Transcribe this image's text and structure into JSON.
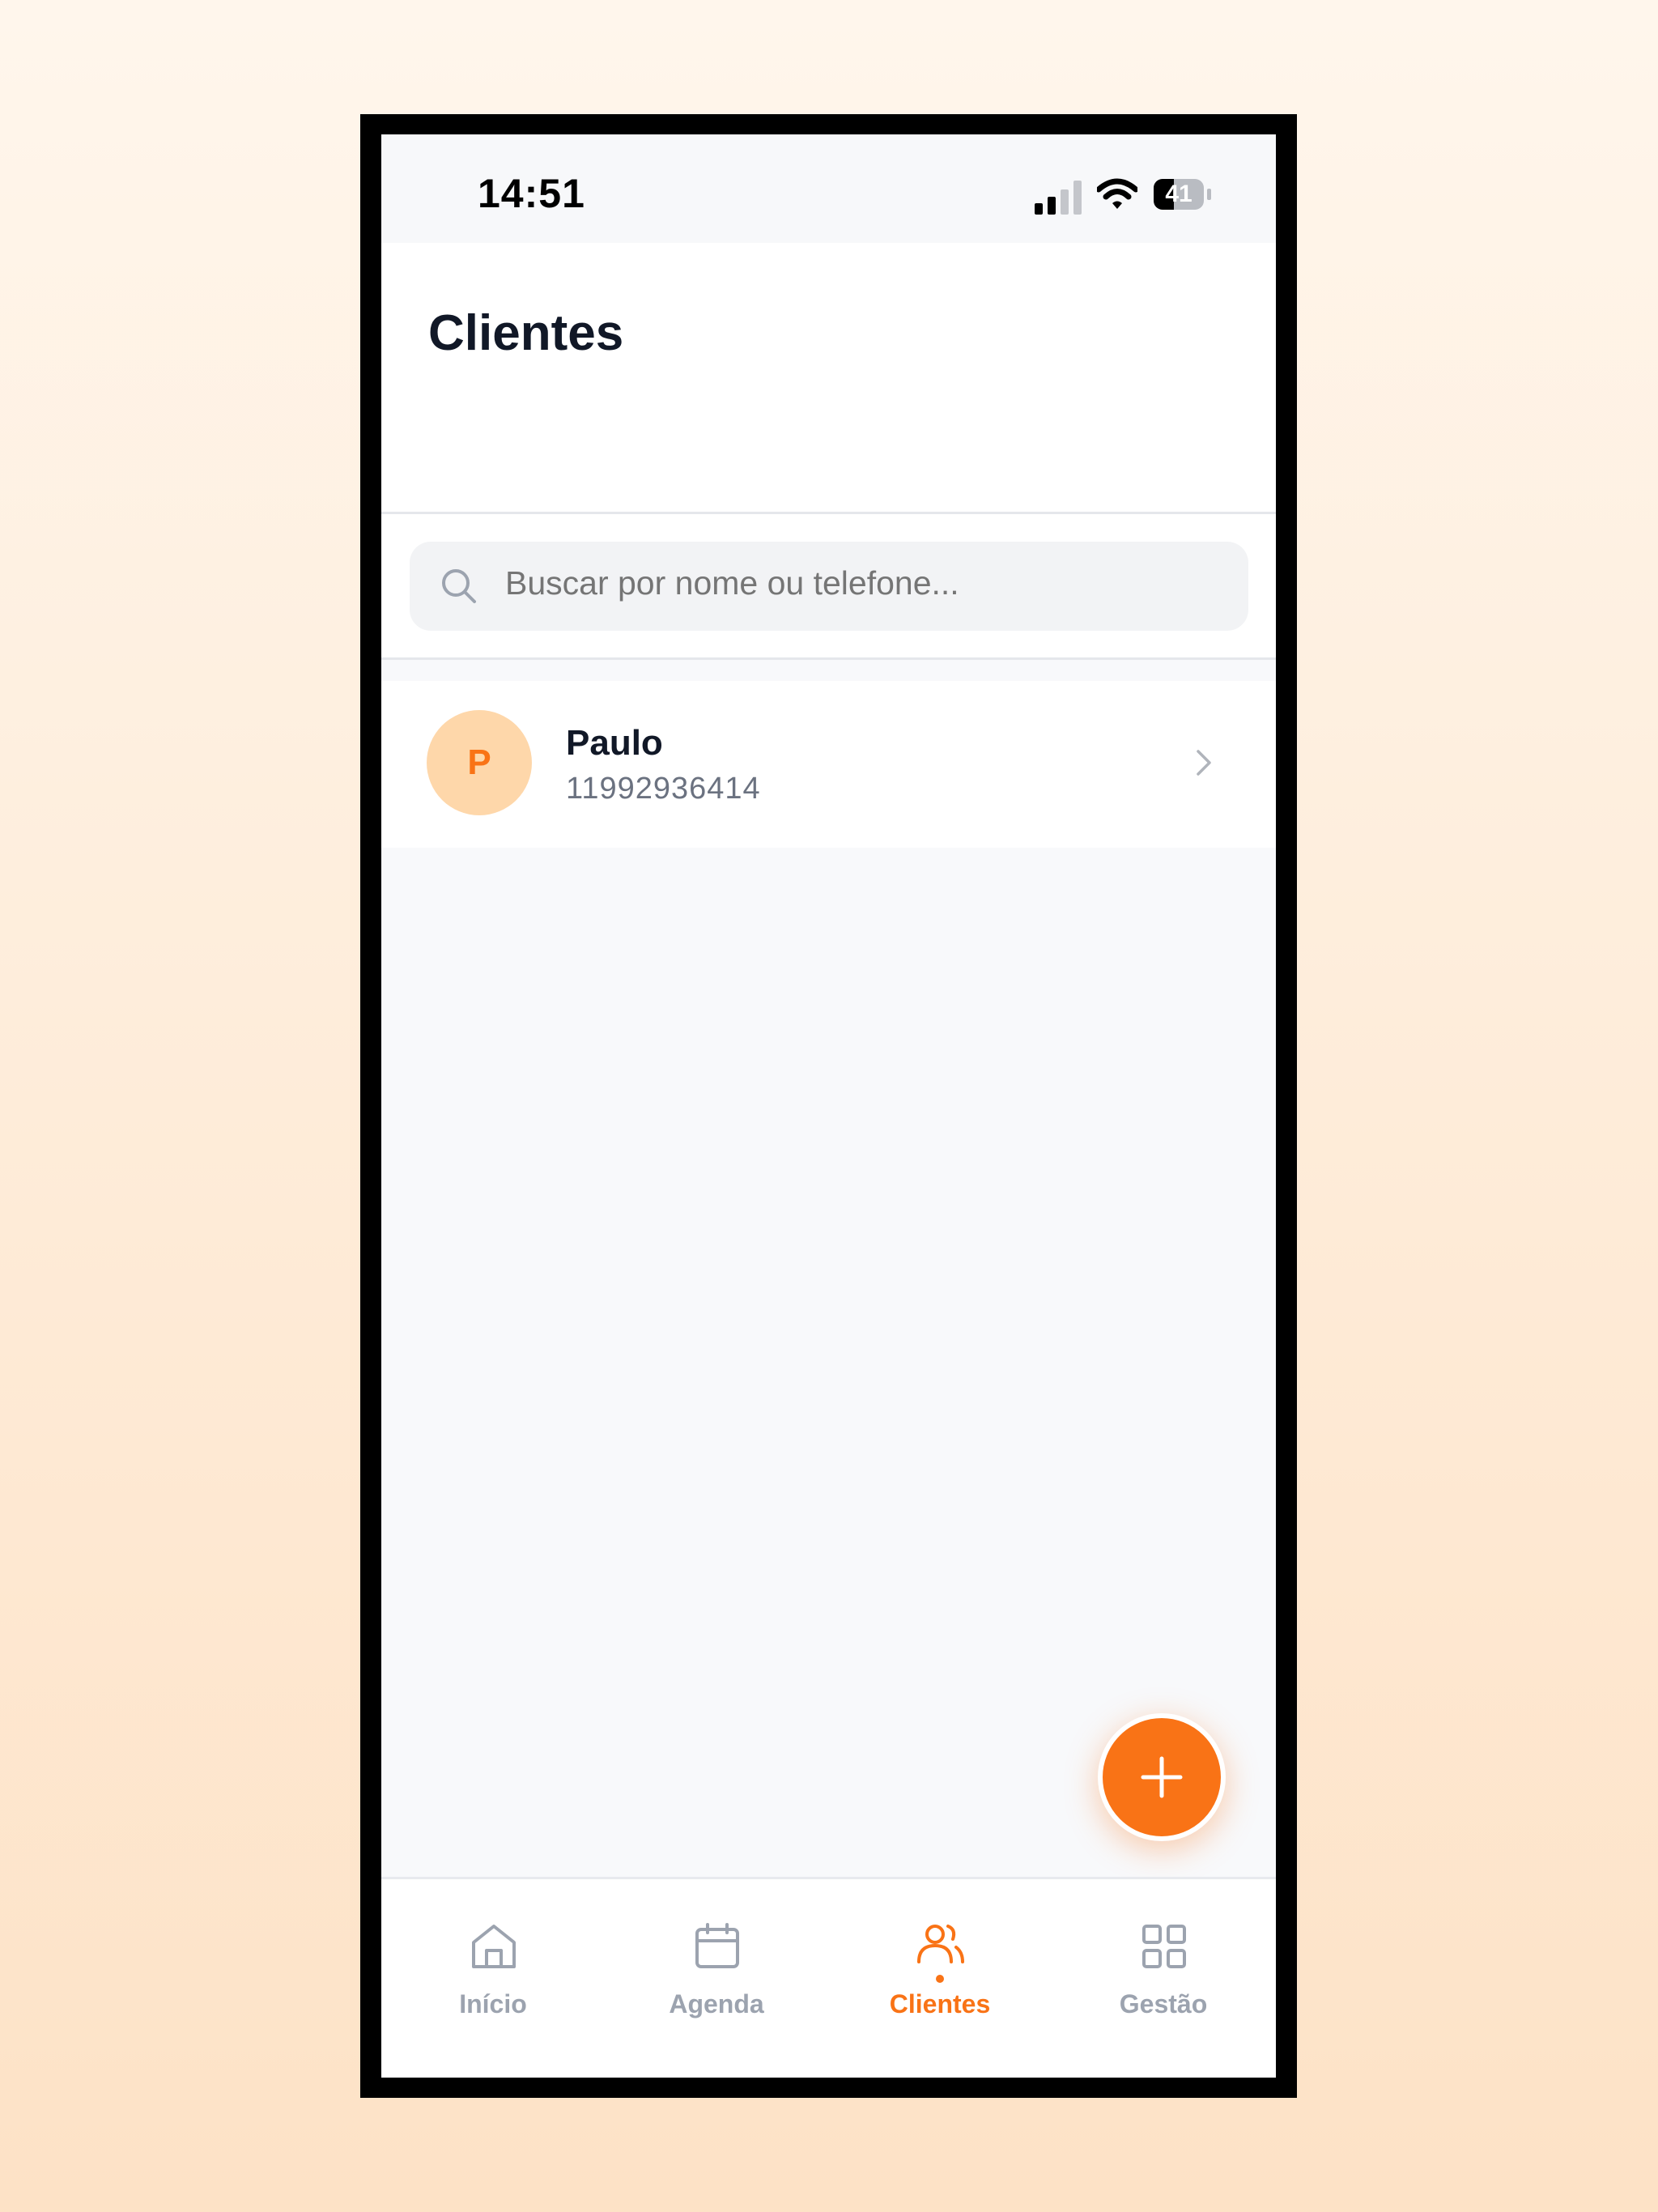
{
  "status_bar": {
    "time": "14:51",
    "battery_level": "41",
    "battery_fraction": 0.41
  },
  "header": {
    "title": "Clientes"
  },
  "search": {
    "placeholder": "Buscar por nome ou telefone..."
  },
  "clients": [
    {
      "initial": "P",
      "name": "Paulo",
      "phone": "11992936414"
    }
  ],
  "fab": {
    "icon": "plus-icon"
  },
  "nav": {
    "items": [
      {
        "label": "Início",
        "icon": "home-icon",
        "active": false
      },
      {
        "label": "Agenda",
        "icon": "calendar-icon",
        "active": false
      },
      {
        "label": "Clientes",
        "icon": "users-icon",
        "active": true
      },
      {
        "label": "Gestão",
        "icon": "grid-icon",
        "active": false
      }
    ]
  },
  "colors": {
    "accent": "#f97316",
    "avatar_bg": "#fed7aa",
    "title": "#111827",
    "muted": "#9ca3af"
  }
}
